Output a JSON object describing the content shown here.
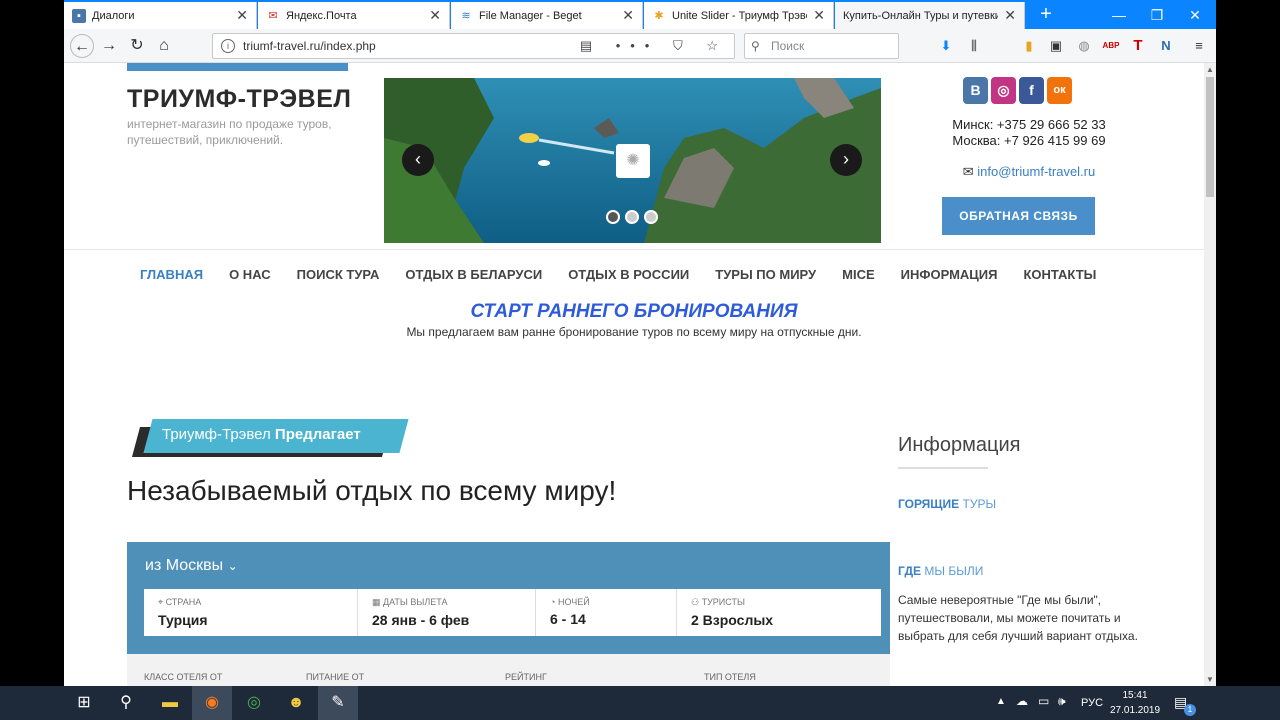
{
  "browser": {
    "tabs": [
      {
        "title": "Диалоги",
        "icon": "chat-icon",
        "color": "#4a76a8"
      },
      {
        "title": "Яндекс.Почта",
        "icon": "mail-icon",
        "color": "#d93025"
      },
      {
        "title": "File Manager - Beget",
        "icon": "beget-icon",
        "color": "#2b83c6"
      },
      {
        "title": "Unite Slider - Триумф Трэвел",
        "icon": "joomla-icon",
        "color": "#e8a321"
      },
      {
        "title": "Купить-Онлайн Туры и путевки п",
        "icon": "page-icon",
        "color": "#999"
      }
    ],
    "url": "triumf-travel.ru/index.php",
    "search_placeholder": "Поиск"
  },
  "header": {
    "logo": "ТРИУМФ-ТРЭВЕЛ",
    "tagline": "интернет-магазин по продаже туров, путешествий, приключений.",
    "phone_minsk": "Минск: +375 29 666 52 33",
    "phone_moscow": "Москва: +7 926 415 99 69",
    "email": "info@triumf-travel.ru",
    "callback_label": "ОБРАТНАЯ СВЯЗЬ",
    "social": [
      "В",
      "◎",
      "f",
      "ок"
    ]
  },
  "nav": [
    "ГЛАВНАЯ",
    "О НАС",
    "ПОИСК ТУРА",
    "ОТДЫХ В БЕЛАРУСИ",
    "ОТДЫХ В РОССИИ",
    "ТУРЫ ПО МИРУ",
    "MICE",
    "ИНФОРМАЦИЯ",
    "КОНТАКТЫ"
  ],
  "promo": {
    "title": "СТАРТ РАННЕГО БРОНИРОВАНИЯ",
    "subtitle": "Мы предлагаем вам ранне бронирование туров по всему миру на отпускные дни."
  },
  "offer": {
    "banner_light": "Триумф-Трэвел",
    "banner_bold": "Предлагает",
    "headline": "Незабываемый отдых по всему миру!"
  },
  "search": {
    "from_city": "из Москвы",
    "fields": [
      {
        "label": "СТРАНА",
        "value": "Турция"
      },
      {
        "label": "ДАТЫ ВЫЛЕТА",
        "value": "28 янв - 6 фев"
      },
      {
        "label": "НОЧЕЙ",
        "value": "6 - 14"
      },
      {
        "label": "ТУРИСТЫ",
        "value": "2 Взрослых"
      }
    ],
    "filters": [
      "КЛАСС ОТЕЛЯ ОТ",
      "ПИТАНИЕ ОТ",
      "РЕЙТИНГ",
      "ТИП ОТЕЛЯ"
    ]
  },
  "sidebar": {
    "title": "Информация",
    "link1_bold": "ГОРЯЩИЕ",
    "link1_rest": "ТУРЫ",
    "link2_bold": "ГДЕ",
    "link2_rest": "МЫ БЫЛИ",
    "description": "Самые невероятные \"Где мы были\", путешествовали, мы можете почитать и выбрать для себя лучший вариант отдыха."
  },
  "taskbar": {
    "lang": "РУС",
    "time": "15:41",
    "date": "27.01.2019",
    "notifications": "1"
  }
}
